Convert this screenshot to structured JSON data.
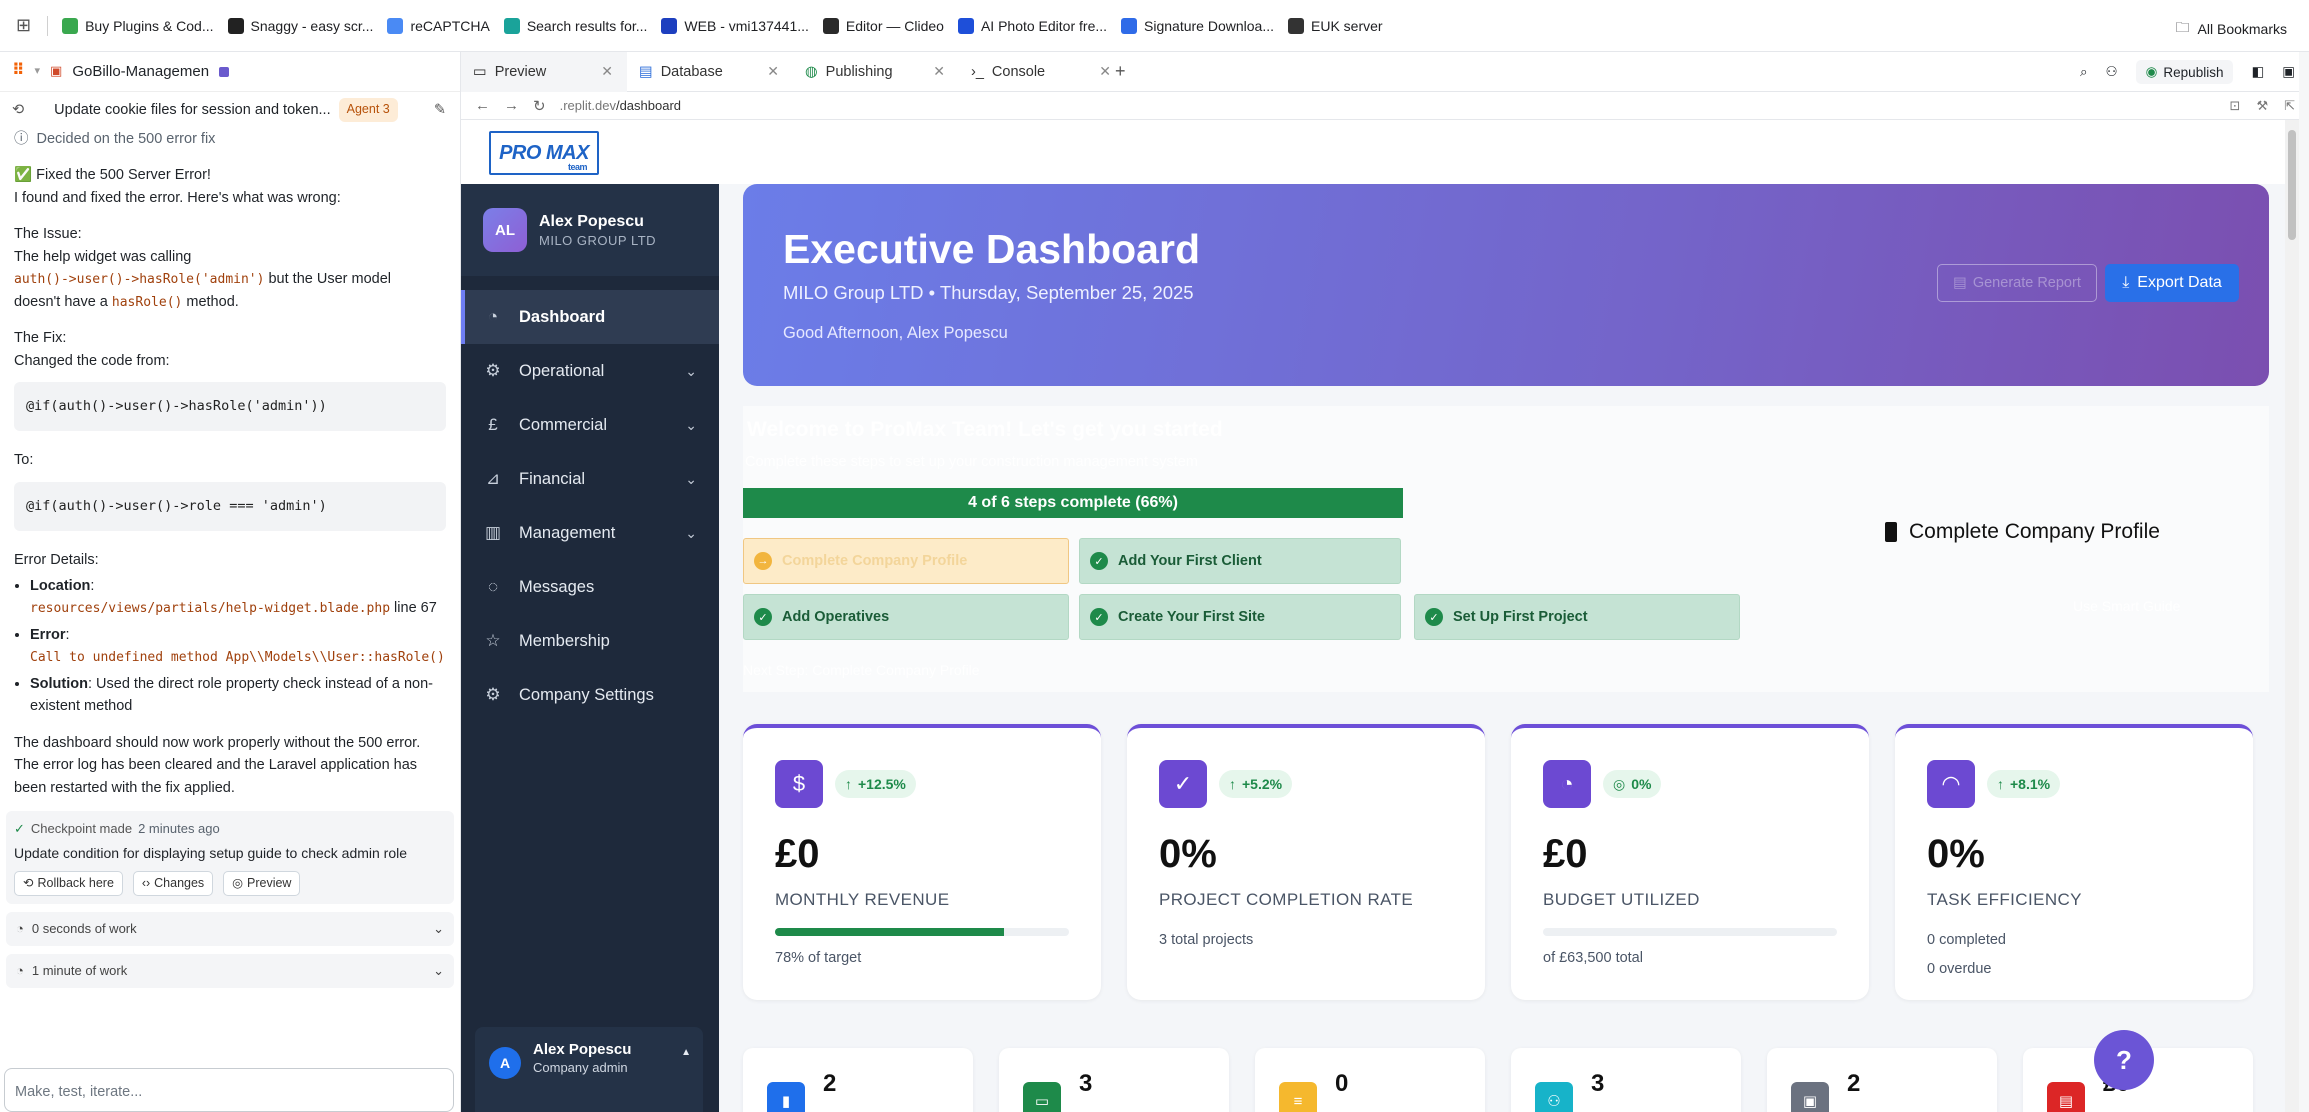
{
  "bookmarks": {
    "items": [
      {
        "label": "Buy Plugins & Cod...",
        "color": "#3aa84f"
      },
      {
        "label": "Snaggy - easy scr...",
        "color": "#222222"
      },
      {
        "label": "reCAPTCHA",
        "color": "#4a8af4"
      },
      {
        "label": "Search results for...",
        "color": "#1aa39a"
      },
      {
        "label": "WEB - vmi137441...",
        "color": "#1d3fbf"
      },
      {
        "label": "Editor — Clideo",
        "color": "#2a2a2a"
      },
      {
        "label": "AI Photo Editor fre...",
        "color": "#1e4fd9"
      },
      {
        "label": "Signature Downloa...",
        "color": "#2f6be8"
      },
      {
        "label": "EUK server",
        "color": "#333333"
      }
    ],
    "all_bookmarks": "All Bookmarks"
  },
  "agent": {
    "project": "GoBillo-Managemen",
    "thread_title": "Update cookie files for session and token...",
    "agent_badge": "Agent 3",
    "decided": "Decided on the 500 error fix",
    "fixed_title": "✅ Fixed the 500 Server Error!",
    "fixed_intro": "I found and fixed the error. Here's what was wrong:",
    "issue_heading": "The Issue:",
    "issue_line1": "The help widget was calling",
    "issue_code1": "auth()->user()->hasRole('admin')",
    "issue_line2": " but the User model",
    "issue_line3": "doesn't have a ",
    "issue_code2": "hasRole()",
    "issue_line4": " method.",
    "fix_heading": "The Fix:",
    "fix_line": "Changed the code from:",
    "code_from": "@if(auth()->user()->hasRole('admin'))",
    "to_label": "To:",
    "code_to": "@if(auth()->user()->role === 'admin')",
    "error_details": "Error Details:",
    "location_label": "Location",
    "location_code": "resources/views/partials/help-widget.blade.php",
    "location_line": " line 67",
    "error_label": "Error",
    "error_code": "Call to undefined method App\\\\Models\\\\User::hasRole()",
    "solution_label": "Solution",
    "solution_text": ": Used the direct role property check instead of a non-existent method",
    "summary": "The dashboard should now work properly without the 500 error. The error log has been cleared and the Laravel application has been restarted with the fix applied.",
    "checkpoint_made": "Checkpoint made",
    "checkpoint_time": "2 minutes ago",
    "checkpoint_title": "Update condition for displaying setup guide to check admin role",
    "rollback": "Rollback here",
    "changes": "Changes",
    "preview": "Preview",
    "work1": "0 seconds of work",
    "work2": "1 minute of work",
    "input_placeholder": "Make, test, iterate..."
  },
  "workspace": {
    "tabs": [
      "Preview",
      "Database",
      "Publishing",
      "Console"
    ],
    "republish": "Republish",
    "url_prefix": ".replit.dev",
    "url_path": "/dashboard"
  },
  "app": {
    "logo_text": "PRO MAX",
    "logo_sub": "team",
    "user": {
      "initials": "AL",
      "name": "Alex Popescu",
      "company": "MILO GROUP LTD"
    },
    "nav": [
      {
        "label": "Dashboard",
        "icon": "gauge-icon",
        "expandable": false
      },
      {
        "label": "Operational",
        "icon": "gear-icon",
        "expandable": true
      },
      {
        "label": "Commercial",
        "icon": "pound-icon",
        "expandable": true
      },
      {
        "label": "Financial",
        "icon": "chart-icon",
        "expandable": true
      },
      {
        "label": "Management",
        "icon": "building-icon",
        "expandable": true
      },
      {
        "label": "Messages",
        "icon": "message-icon",
        "expandable": false
      },
      {
        "label": "Membership",
        "icon": "star-icon",
        "expandable": false
      },
      {
        "label": "Company Settings",
        "icon": "gear-icon",
        "expandable": false
      }
    ],
    "bottom_user": {
      "initial": "A",
      "name": "Alex Popescu",
      "role": "Company admin"
    },
    "banner": {
      "title": "Executive Dashboard",
      "subtitle": "MILO Group LTD • Thursday, September 25, 2025",
      "greeting": "Good Afternoon, Alex Popescu",
      "ghost_button": "Generate Report",
      "export_button": "Export Data"
    },
    "setup": {
      "ghost_title": "Welcome to ProMax Team! Let's get you started",
      "ghost_sub": "Complete these steps to set up your construction management system",
      "ghost_next": "Next Step: Complete Company Profile",
      "ghost_more": "Use Smart Guide",
      "progress_text": "4 of 6 steps complete (66%)",
      "progress_fraction": 0.66,
      "steps": [
        {
          "label": "Complete Company Profile",
          "done": false
        },
        {
          "label": "Add Your First Client",
          "done": true
        },
        {
          "label": "Add Operatives",
          "done": true
        },
        {
          "label": "Create Your First Site",
          "done": true
        },
        {
          "label": "Set Up First Project",
          "done": true
        }
      ],
      "current_step": "Complete Company Profile"
    },
    "stats": [
      {
        "icon": "dollar-icon",
        "change": "+12.5%",
        "value": "£0",
        "label": "MONTHLY REVENUE",
        "progress": 0.78,
        "note": "78% of target"
      },
      {
        "icon": "check-circle-icon",
        "change": "+5.2%",
        "value": "0%",
        "label": "PROJECT COMPLETION RATE",
        "note": "3 total projects"
      },
      {
        "icon": "pie-chart-icon",
        "change": "0%",
        "value": "£0",
        "label": "BUDGET UTILIZED",
        "progress": 0.0,
        "note": "of £63,500 total"
      },
      {
        "icon": "speedometer-icon",
        "change": "+8.1%",
        "value": "0%",
        "label": "TASK EFFICIENCY",
        "note": "0 completed",
        "note2": "0 overdue"
      }
    ],
    "mini_stats": [
      {
        "value": "2",
        "color": "#1f6feb",
        "icon": "building-icon"
      },
      {
        "value": "3",
        "color": "#1e8a4a",
        "icon": "folder-icon"
      },
      {
        "value": "0",
        "color": "#f5b82e",
        "icon": "list-icon"
      },
      {
        "value": "3",
        "color": "#17b3c9",
        "icon": "users-icon"
      },
      {
        "value": "2",
        "color": "#6b7280",
        "icon": "id-card-icon"
      },
      {
        "value": "£0",
        "color": "#dc2626",
        "icon": "invoice-icon"
      }
    ],
    "help_label": "?"
  }
}
